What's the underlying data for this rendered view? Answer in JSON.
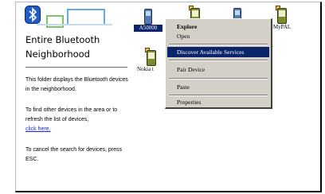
{
  "sidebar": {
    "title": "Entire Bluetooth Neighborhood",
    "para1": "This folder displays the Bluetooth devices in the neighborhood.",
    "para2_before": "To find other devices in the area or to refresh the list of devices,",
    "para2_link": "click here.",
    "para3": "To cancel the search for devices, press ESC."
  },
  "devices": [
    {
      "label": "A50000",
      "icon": "phone-icon"
    },
    {
      "label": "",
      "icon": "pda-icon"
    },
    {
      "label": "",
      "icon": "phone-icon"
    },
    {
      "label": "MyPAL",
      "icon": "pda-icon"
    },
    {
      "label": "Nokia t",
      "icon": "pda-icon"
    }
  ],
  "context_menu": {
    "items": [
      {
        "label": "Explore",
        "bold": true
      },
      {
        "label": "Open"
      },
      {
        "label": "Discover Available Services",
        "highlighted": true
      },
      {
        "label": "Pair Device"
      },
      {
        "label": "Paste"
      },
      {
        "label": "Properties"
      }
    ]
  },
  "colors": {
    "selection": "#0a246a",
    "menu_bg": "#d4d0c8",
    "link": "#1a29c8"
  }
}
